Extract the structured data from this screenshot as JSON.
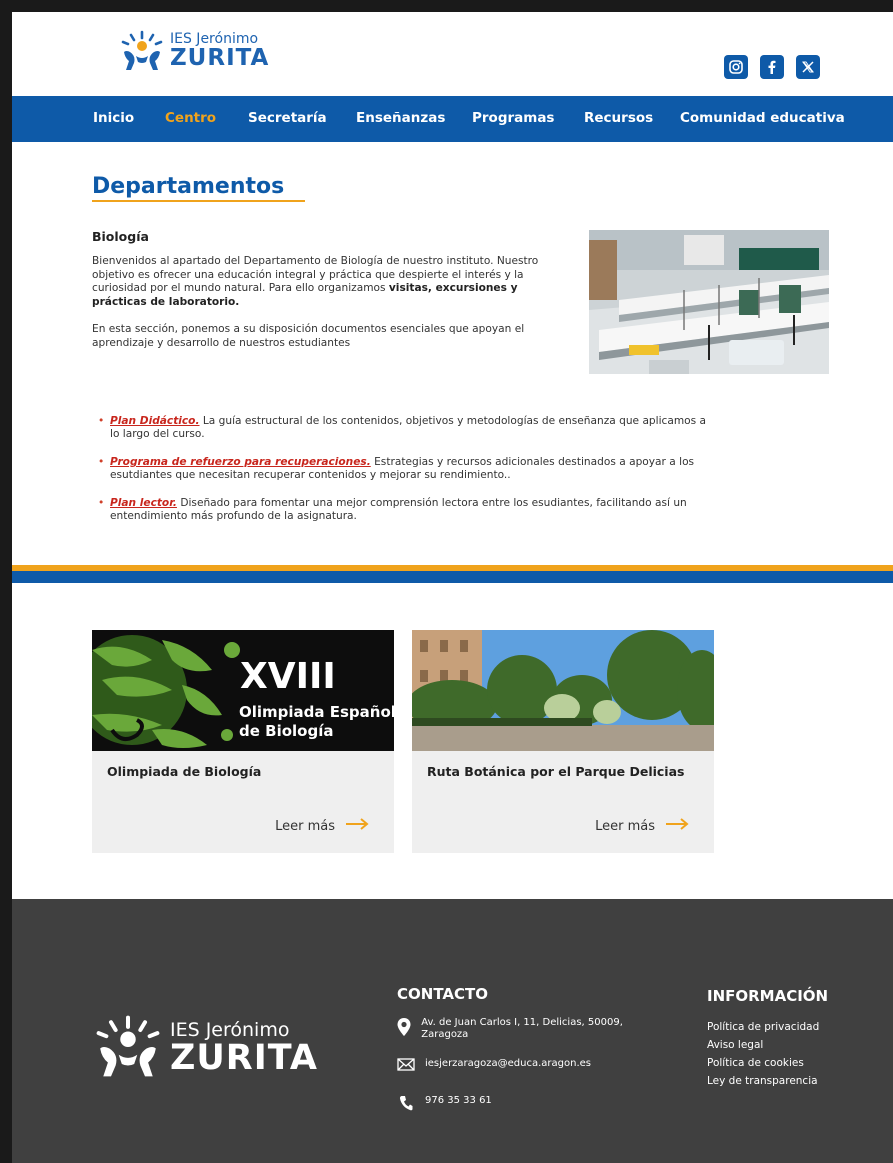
{
  "brand": {
    "name_line1": "IES Jerónimo",
    "name_line2": "ZURITA",
    "primary_color": "#0e5aa8",
    "accent_color": "#f0a31c"
  },
  "social": [
    "instagram-icon",
    "facebook-icon",
    "x-icon"
  ],
  "nav": {
    "items": [
      {
        "label": "Inicio"
      },
      {
        "label": "Centro",
        "active": true
      },
      {
        "label": "Secretaría"
      },
      {
        "label": "Enseñanzas"
      },
      {
        "label": "Programas"
      },
      {
        "label": "Recursos"
      },
      {
        "label": "Comunidad educativa"
      }
    ]
  },
  "main": {
    "title": "Departamentos",
    "subtitle": "Biología",
    "intro_text": "Bienvenidos al apartado del Departamento de Biología de nuestro instituto. Nuestro objetivo es ofrecer una educación integral y práctica que despierte el interés y la curiosidad por el mundo natural. Para ello organizamos ",
    "intro_bold": "visitas, excursiones y prácticas de laboratorio.",
    "intro2": "En esta sección, ponemos a su disposición documentos esenciales que apoyan el aprendizaje y desarrollo de nuestros estudiantes",
    "bullets": [
      {
        "link": "Plan Didáctico.",
        "text": " La guía estructural de los contenidos, objetivos y metodologías de enseñanza que aplicamos a lo largo del curso."
      },
      {
        "link": "Programa de refuerzo para recuperaciones.",
        "text": " Estrategias y recursos adicionales destinados a apoyar a los esutdiantes que necesitan recuperar contenidos y mejorar su rendimiento.."
      },
      {
        "link": "Plan lector.",
        "text": " Diseñado para fomentar una mejor comprensión lectora entre los esudiantes, facilitando así un entendimiento más profundo de la asignatura."
      }
    ]
  },
  "cards": [
    {
      "image_text1": "XVIII",
      "image_text2": "Olimpiada Española",
      "image_text3": "de Biología",
      "title": "Olimpiada de  Biología",
      "more": "Leer más"
    },
    {
      "title": "Ruta Botánica por el Parque Delicias",
      "more": "Leer más"
    }
  ],
  "footer": {
    "contact_title": "CONTACTO",
    "address": "Av. de Juan Carlos I, 11, Delicias, 50009, Zaragoza",
    "email": "iesjerzaragoza@educa.aragon.es",
    "phone": "976 35 33 61",
    "info_title": "INFORMACIÓN",
    "links": [
      "Política de privacidad",
      "Aviso legal",
      "Política de cookies",
      "Ley de transparencia"
    ]
  }
}
